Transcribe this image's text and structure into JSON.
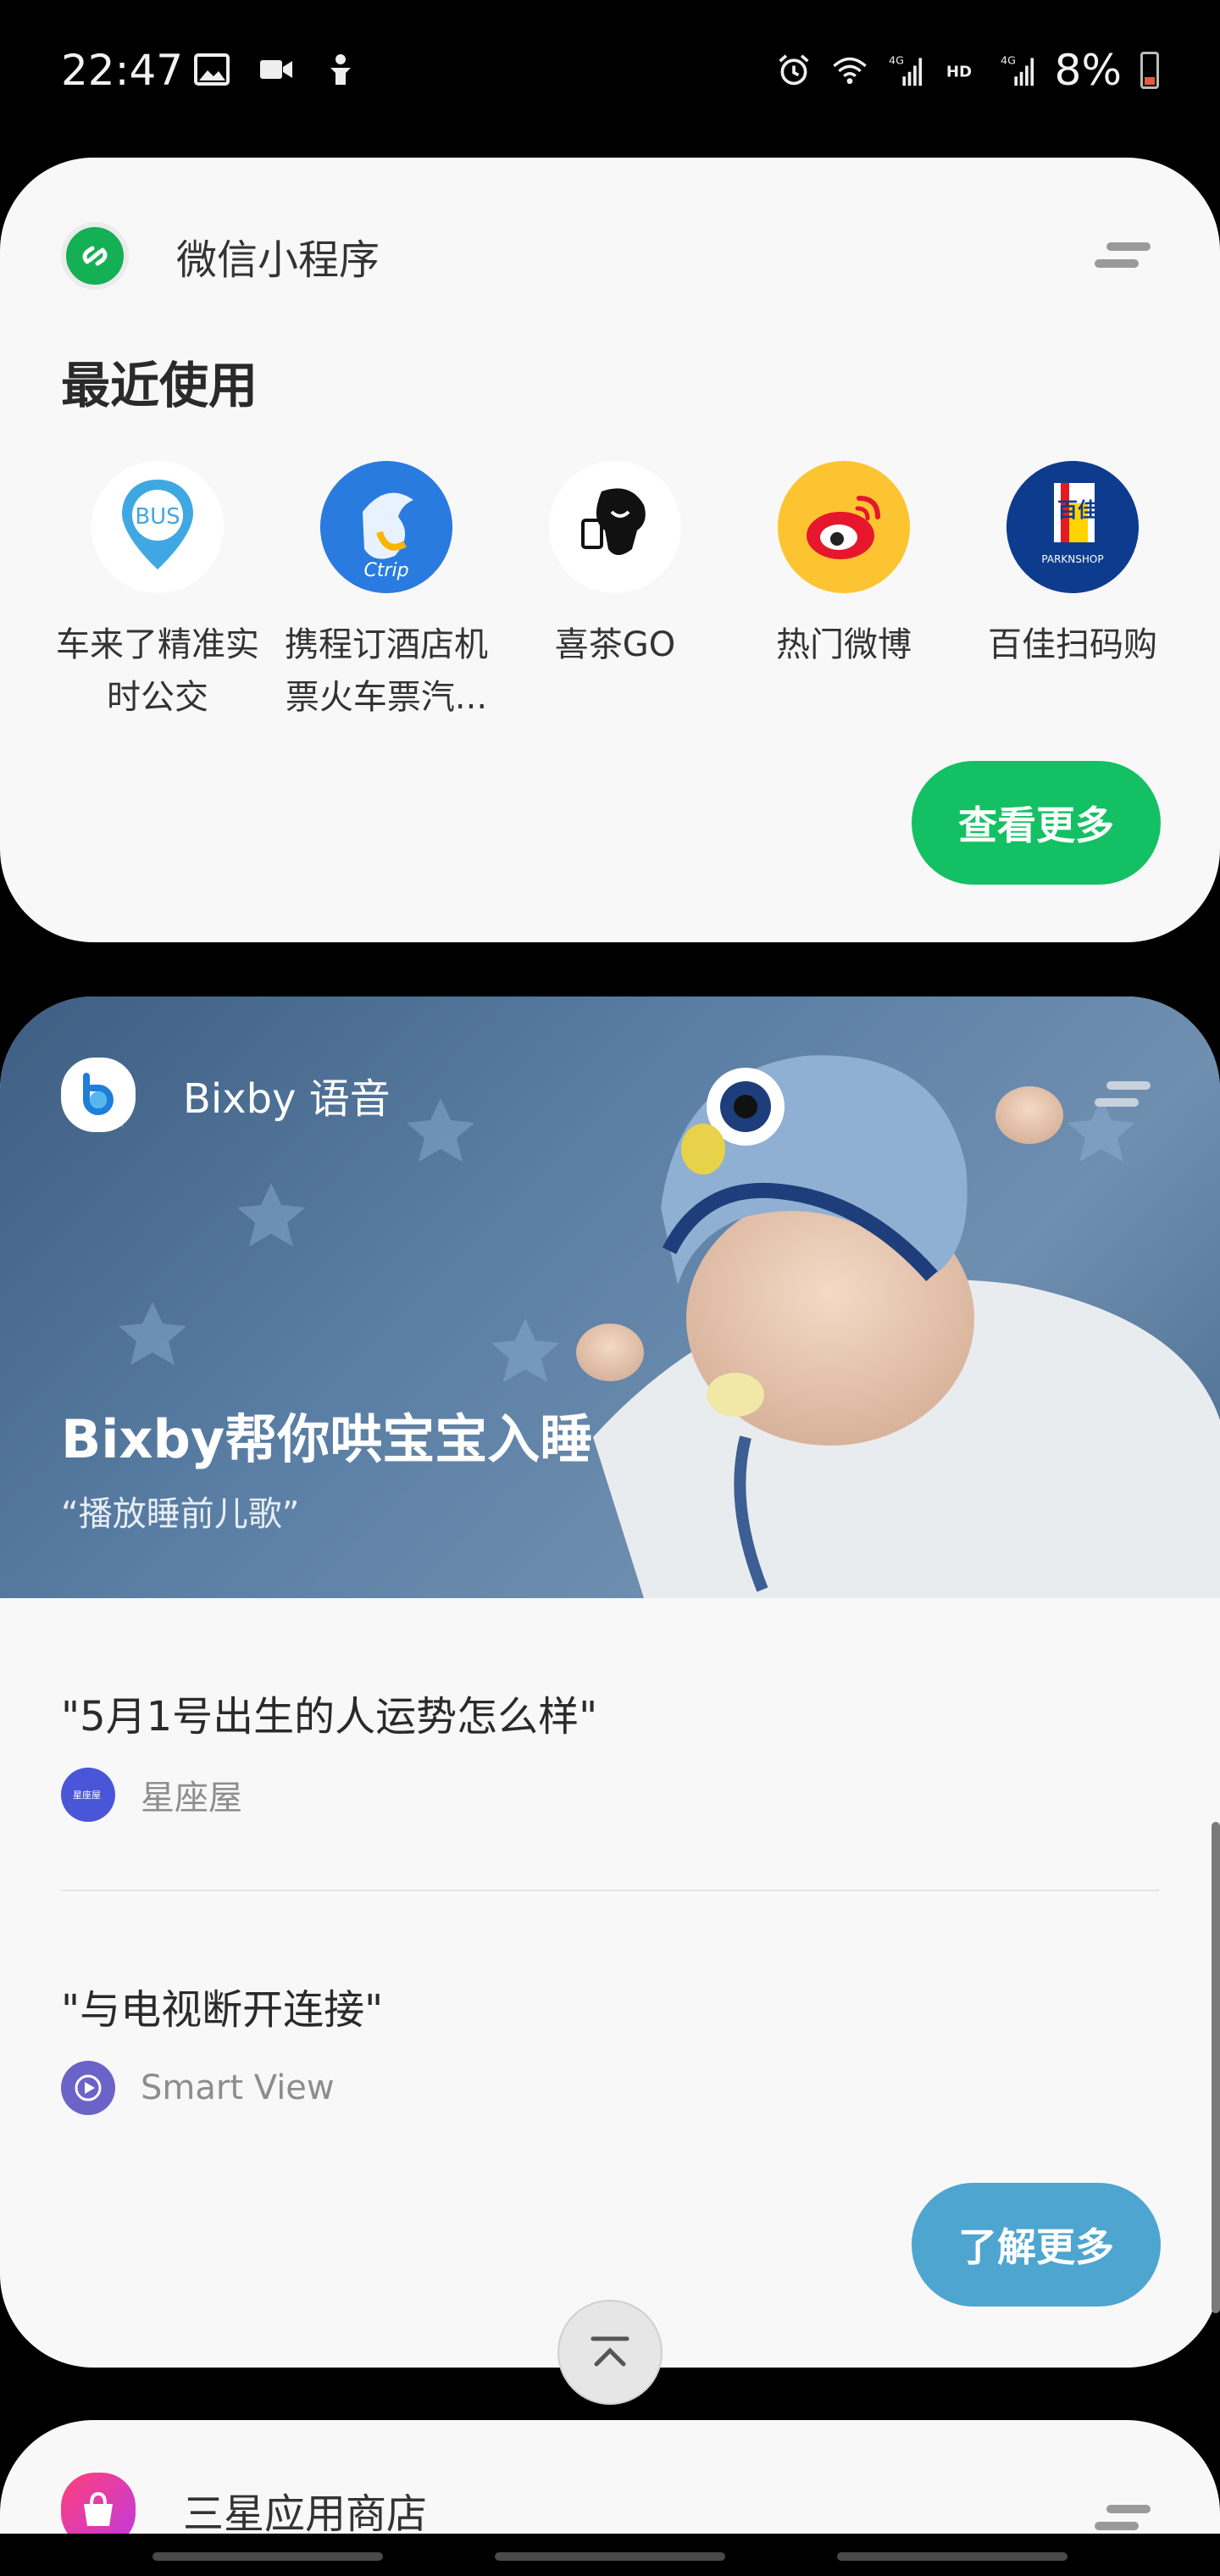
{
  "status_bar": {
    "time": "22:47",
    "battery": "8%",
    "left_icons": [
      "image-icon",
      "video-icon",
      "accessibility-icon"
    ],
    "right_icons": [
      "alarm-icon",
      "wifi-icon",
      "signal-4g-icon",
      "hd-icon",
      "signal-4g-icon"
    ]
  },
  "wechat_card": {
    "title": "微信小程序",
    "section_title": "最近使用",
    "apps": [
      {
        "name": "车来了精准实时公交",
        "icon": "bus-icon"
      },
      {
        "name": "携程订酒店机票火车票汽...",
        "icon": "ctrip-icon"
      },
      {
        "name": "喜茶GO",
        "icon": "heytea-icon"
      },
      {
        "name": "热门微博",
        "icon": "weibo-icon"
      },
      {
        "name": "百佳扫码购",
        "icon": "parknshop-icon"
      }
    ],
    "more_button": "查看更多",
    "accent": "#13c063"
  },
  "bixby_card": {
    "title": "Bixby 语音",
    "hero_title": "Bixby帮你哄宝宝入睡",
    "hero_subtitle": "“播放睡前儿歌”",
    "suggestions": [
      {
        "text": "\"5月1号出生的人运势怎么样\"",
        "source": "星座屋"
      },
      {
        "text": "\"与电视断开连接\"",
        "source": "Smart View"
      }
    ],
    "more_button": "了解更多",
    "accent": "#4ea5d0"
  },
  "store_card": {
    "title": "三星应用商店"
  }
}
